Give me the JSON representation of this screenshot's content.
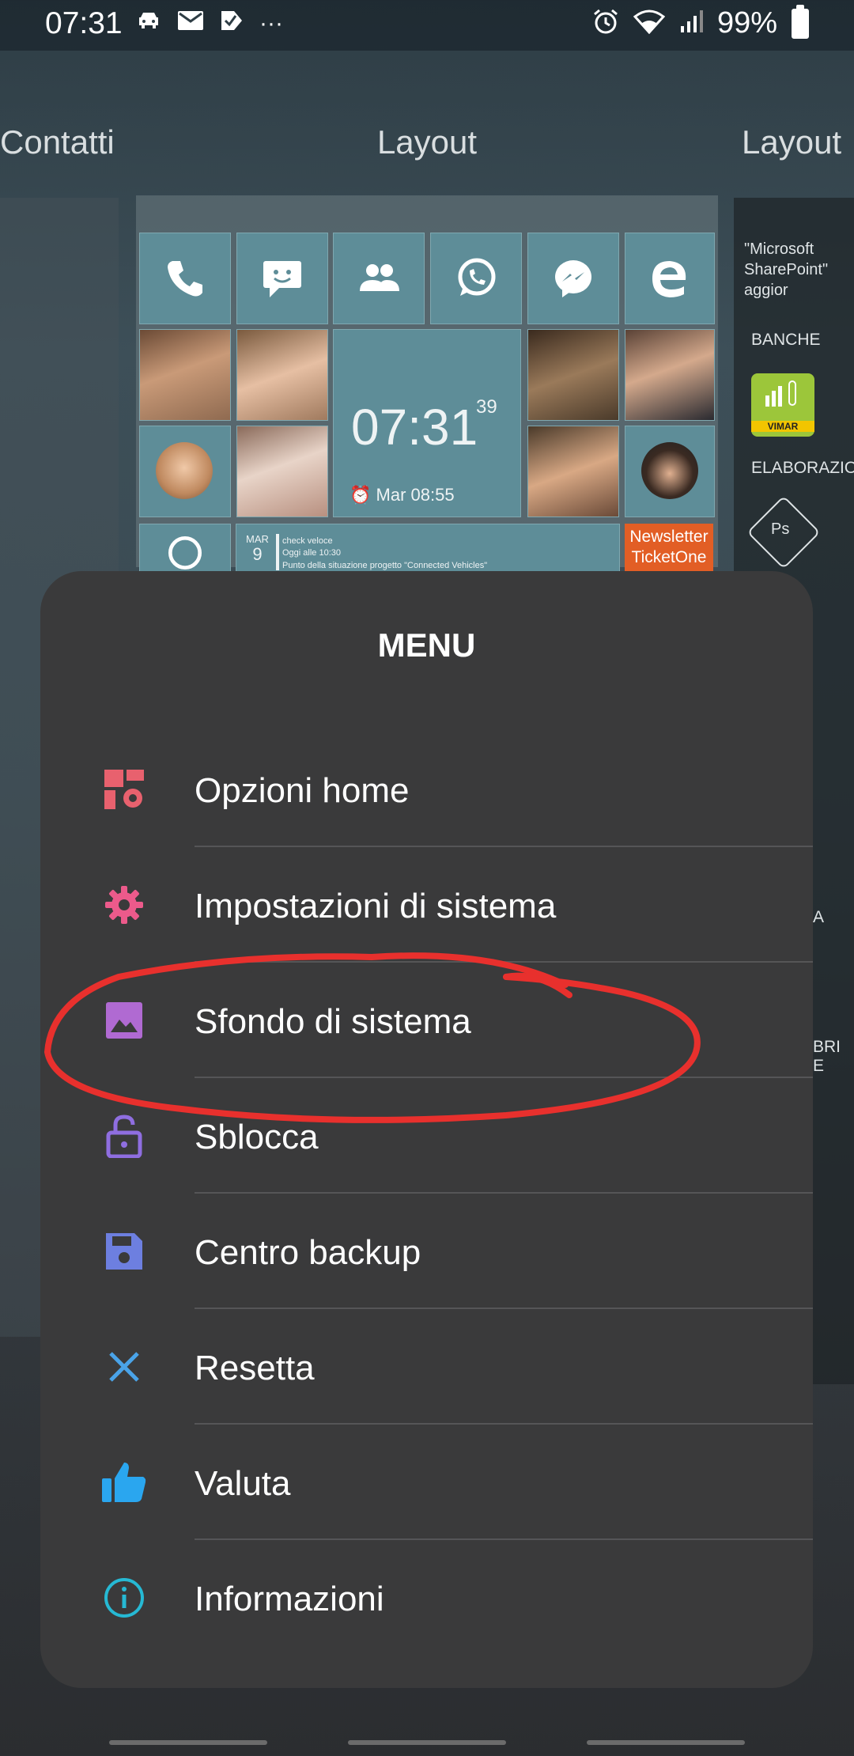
{
  "status_bar": {
    "time": "07:31",
    "left_icons": [
      "car-icon",
      "mail-icon",
      "task-icon",
      "more-icon"
    ],
    "more_dots": "···",
    "battery": "99%",
    "right_icons": [
      "alarm-icon",
      "wifi-icon",
      "signal-icon",
      "battery-icon"
    ]
  },
  "screens": {
    "left_title": "Contatti",
    "center_title": "Layout",
    "right_title": "Layout"
  },
  "home_preview": {
    "clock_time": "07:31",
    "clock_seconds": "39",
    "alarm_text": "Mar 08:55",
    "agenda_day": "MAR",
    "agenda_date": "9",
    "agenda_line1": "check veloce",
    "agenda_line2": "Oggi alle 10:30",
    "agenda_line3": "Punto della situazione progetto \"Connected Vehicles\"",
    "newsletter": "Newsletter TicketOne"
  },
  "right_panel": {
    "note": "\"Microsoft SharePoint\" aggior",
    "label_banche": "BANCHE",
    "label_elaborazioni": "ELABORAZIO",
    "vimar_label": "VIMAR",
    "ps_label": "Ps",
    "label_a": "A",
    "label_bri": "BRI E"
  },
  "menu": {
    "title": "MENU",
    "items": [
      {
        "label": "Opzioni home",
        "icon": "home-options-icon",
        "color": "#e8616e"
      },
      {
        "label": "Impostazioni di sistema",
        "icon": "gear-icon",
        "color": "#ec5a8b"
      },
      {
        "label": "Sfondo di sistema",
        "icon": "image-icon",
        "color": "#b06ad2"
      },
      {
        "label": "Sblocca",
        "icon": "unlock-icon",
        "color": "#8f6ee0"
      },
      {
        "label": "Centro backup",
        "icon": "save-icon",
        "color": "#6d7fe0"
      },
      {
        "label": "Resetta",
        "icon": "close-icon",
        "color": "#4aa3e8"
      },
      {
        "label": "Valuta",
        "icon": "thumbs-up-icon",
        "color": "#2aa6ef"
      },
      {
        "label": "Informazioni",
        "icon": "info-icon",
        "color": "#26b9d4"
      }
    ]
  },
  "annotation": {
    "color": "#e8302d",
    "target": "Sfondo di sistema"
  }
}
